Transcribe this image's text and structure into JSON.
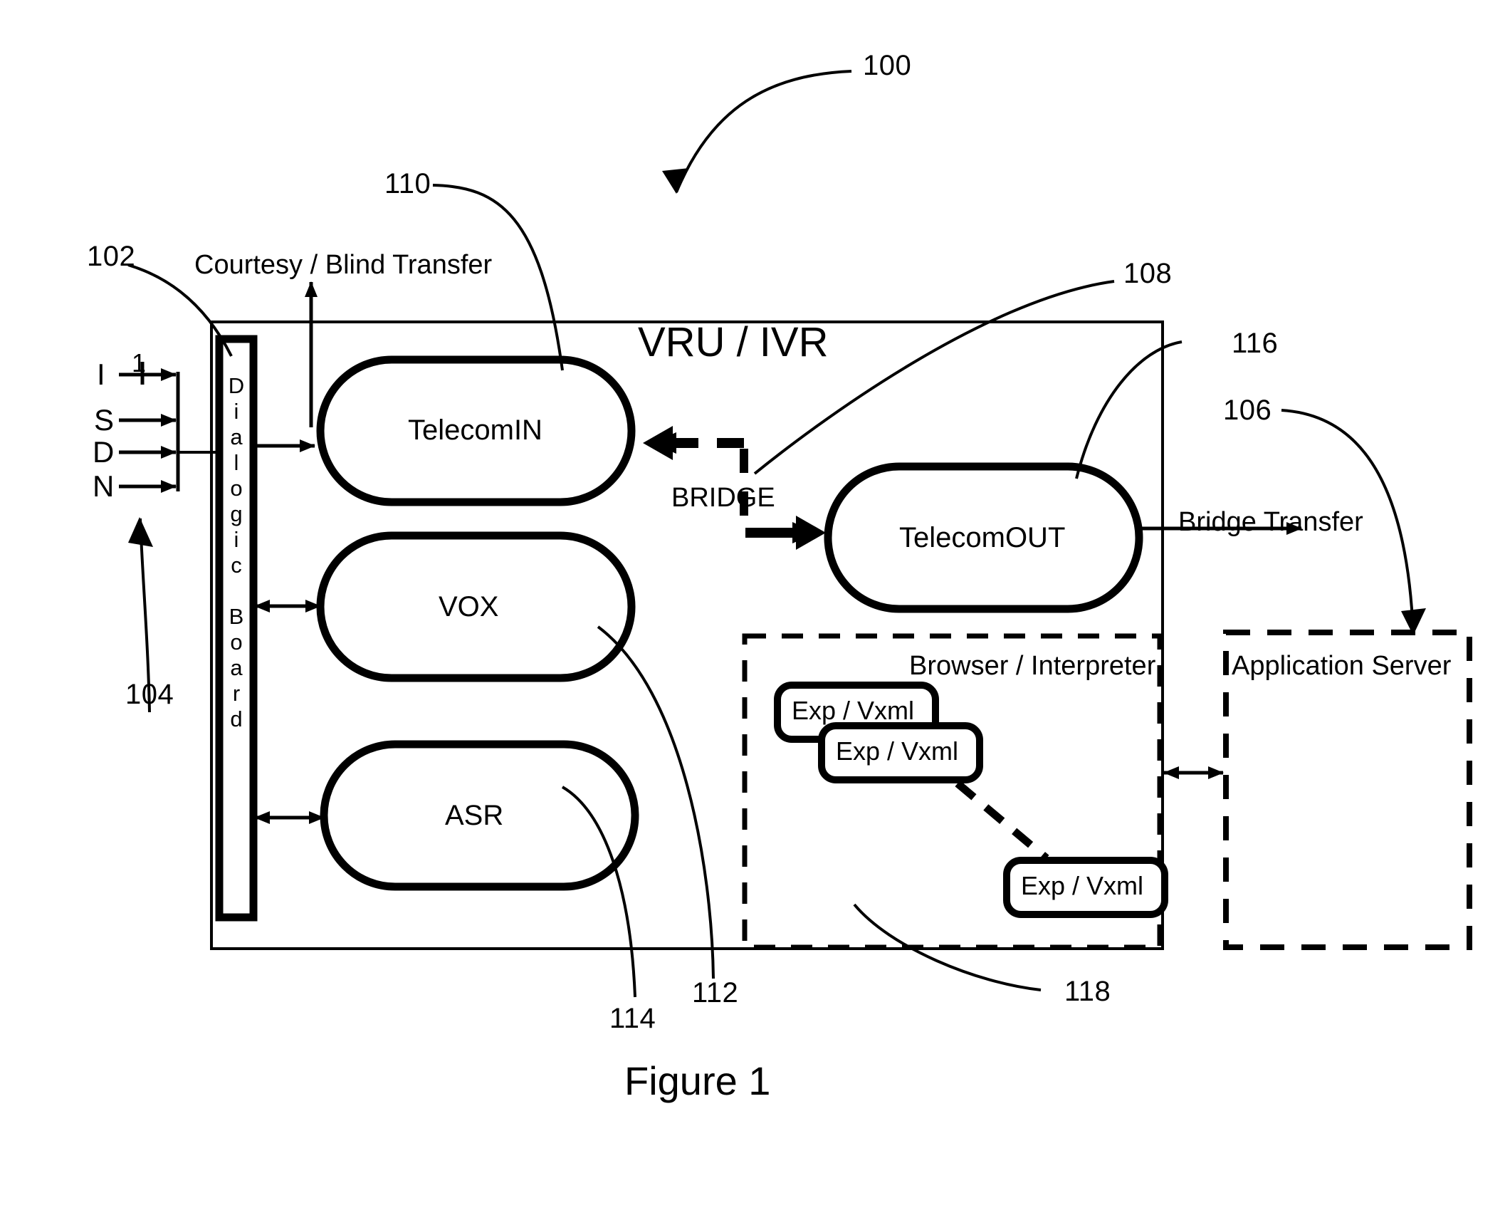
{
  "figure": {
    "caption": "Figure 1",
    "overall_ref": "100"
  },
  "system": {
    "title": "VRU / IVR",
    "ref": "108"
  },
  "network": {
    "letters": [
      "I",
      "S",
      "D",
      "N"
    ],
    "channel_marker": "1",
    "ref": "104"
  },
  "dialogic_board": {
    "label": "Dialogic Board",
    "letters": [
      "D",
      "i",
      "a",
      "l",
      "o",
      "g",
      "i",
      "c",
      " ",
      "B",
      "o",
      "a",
      "r",
      "d"
    ],
    "ref": "102"
  },
  "modules": [
    {
      "label": "TelecomIN",
      "ref": "110"
    },
    {
      "label": "VOX",
      "ref": "112"
    },
    {
      "label": "ASR",
      "ref": "114"
    },
    {
      "label": "TelecomOUT",
      "ref": "116"
    }
  ],
  "bridge": {
    "label": "BRIDGE"
  },
  "transfers": {
    "courtesy_blind": "Courtesy / Blind Transfer",
    "bridge_transfer": "Bridge Transfer"
  },
  "browser": {
    "label": "Browser / Interpreter",
    "ref": "118",
    "documents": [
      {
        "label": "Exp / Vxml"
      },
      {
        "label": "Exp / Vxml"
      },
      {
        "label": "Exp / Vxml"
      }
    ]
  },
  "app_server": {
    "label": "Application Server",
    "ref": "106"
  },
  "colors": {
    "stroke": "#000000",
    "background": "#ffffff"
  }
}
